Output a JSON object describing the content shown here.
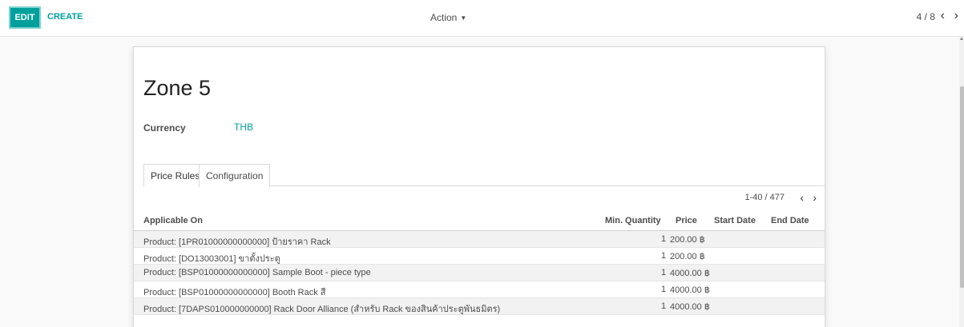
{
  "toolbar": {
    "edit_label": "EDIT",
    "create_label": "CREATE",
    "action_label": "Action",
    "pager_text": "4 / 8"
  },
  "record": {
    "title": "Zone 5",
    "currency_label": "Currency",
    "currency_value": "THB"
  },
  "tabs": [
    {
      "label": "Price Rules",
      "active": true
    },
    {
      "label": "Configuration",
      "active": false
    }
  ],
  "list_pager": "1-40 / 477",
  "table": {
    "headers": {
      "applicable_on": "Applicable On",
      "min_qty": "Min. Quantity",
      "price": "Price",
      "start_date": "Start Date",
      "end_date": "End Date"
    },
    "rows": [
      {
        "applicable_on": "Product: [1PR01000000000000] ป้ายราคา Rack",
        "min_qty": "1",
        "price": "200.00 ฿",
        "start_date": "",
        "end_date": ""
      },
      {
        "applicable_on": "Product: [DO13003001] ขาตั้งประตู",
        "min_qty": "1",
        "price": "200.00 ฿",
        "start_date": "",
        "end_date": ""
      },
      {
        "applicable_on": "Product: [BSP01000000000000] Sample Boot - piece type",
        "min_qty": "1",
        "price": "4000.00 ฿",
        "start_date": "",
        "end_date": ""
      },
      {
        "applicable_on": "Product: [BSP01000000000000] Booth Rack สี",
        "min_qty": "1",
        "price": "4000.00 ฿",
        "start_date": "",
        "end_date": ""
      },
      {
        "applicable_on": "Product: [7DAPS010000000000] Rack Door Alliance (สำหรับ Rack ของสินค้าประตูพันธมิตร)",
        "min_qty": "1",
        "price": "4000.00 ฿",
        "start_date": "",
        "end_date": ""
      }
    ]
  },
  "icons": {
    "prev": "chevron-left-icon",
    "next": "chevron-right-icon",
    "caret": "caret-down-icon"
  },
  "colors": {
    "accent": "#00a09d",
    "text": "#4c4c4c"
  }
}
